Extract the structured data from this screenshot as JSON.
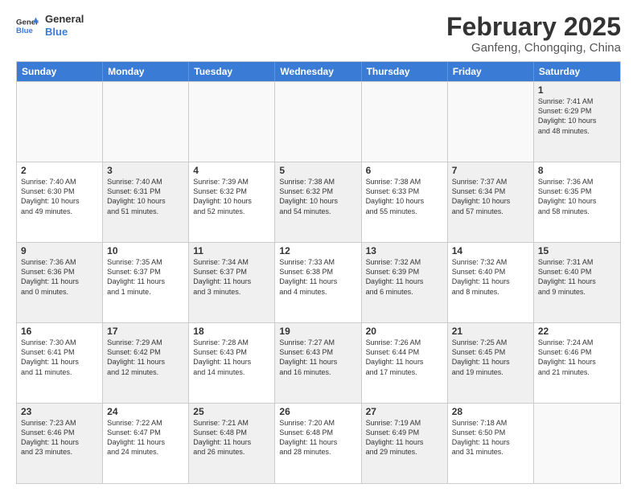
{
  "header": {
    "logo_general": "General",
    "logo_blue": "Blue",
    "main_title": "February 2025",
    "subtitle": "Ganfeng, Chongqing, China"
  },
  "calendar": {
    "days": [
      "Sunday",
      "Monday",
      "Tuesday",
      "Wednesday",
      "Thursday",
      "Friday",
      "Saturday"
    ],
    "rows": [
      [
        {
          "num": "",
          "text": "",
          "empty": true
        },
        {
          "num": "",
          "text": "",
          "empty": true
        },
        {
          "num": "",
          "text": "",
          "empty": true
        },
        {
          "num": "",
          "text": "",
          "empty": true
        },
        {
          "num": "",
          "text": "",
          "empty": true
        },
        {
          "num": "",
          "text": "",
          "empty": true
        },
        {
          "num": "1",
          "text": "Sunrise: 7:41 AM\nSunset: 6:29 PM\nDaylight: 10 hours\nand 48 minutes.",
          "empty": false,
          "shaded": true
        }
      ],
      [
        {
          "num": "2",
          "text": "Sunrise: 7:40 AM\nSunset: 6:30 PM\nDaylight: 10 hours\nand 49 minutes.",
          "empty": false
        },
        {
          "num": "3",
          "text": "Sunrise: 7:40 AM\nSunset: 6:31 PM\nDaylight: 10 hours\nand 51 minutes.",
          "empty": false,
          "shaded": true
        },
        {
          "num": "4",
          "text": "Sunrise: 7:39 AM\nSunset: 6:32 PM\nDaylight: 10 hours\nand 52 minutes.",
          "empty": false
        },
        {
          "num": "5",
          "text": "Sunrise: 7:38 AM\nSunset: 6:32 PM\nDaylight: 10 hours\nand 54 minutes.",
          "empty": false,
          "shaded": true
        },
        {
          "num": "6",
          "text": "Sunrise: 7:38 AM\nSunset: 6:33 PM\nDaylight: 10 hours\nand 55 minutes.",
          "empty": false
        },
        {
          "num": "7",
          "text": "Sunrise: 7:37 AM\nSunset: 6:34 PM\nDaylight: 10 hours\nand 57 minutes.",
          "empty": false,
          "shaded": true
        },
        {
          "num": "8",
          "text": "Sunrise: 7:36 AM\nSunset: 6:35 PM\nDaylight: 10 hours\nand 58 minutes.",
          "empty": false
        }
      ],
      [
        {
          "num": "9",
          "text": "Sunrise: 7:36 AM\nSunset: 6:36 PM\nDaylight: 11 hours\nand 0 minutes.",
          "empty": false,
          "shaded": true
        },
        {
          "num": "10",
          "text": "Sunrise: 7:35 AM\nSunset: 6:37 PM\nDaylight: 11 hours\nand 1 minute.",
          "empty": false
        },
        {
          "num": "11",
          "text": "Sunrise: 7:34 AM\nSunset: 6:37 PM\nDaylight: 11 hours\nand 3 minutes.",
          "empty": false,
          "shaded": true
        },
        {
          "num": "12",
          "text": "Sunrise: 7:33 AM\nSunset: 6:38 PM\nDaylight: 11 hours\nand 4 minutes.",
          "empty": false
        },
        {
          "num": "13",
          "text": "Sunrise: 7:32 AM\nSunset: 6:39 PM\nDaylight: 11 hours\nand 6 minutes.",
          "empty": false,
          "shaded": true
        },
        {
          "num": "14",
          "text": "Sunrise: 7:32 AM\nSunset: 6:40 PM\nDaylight: 11 hours\nand 8 minutes.",
          "empty": false
        },
        {
          "num": "15",
          "text": "Sunrise: 7:31 AM\nSunset: 6:40 PM\nDaylight: 11 hours\nand 9 minutes.",
          "empty": false,
          "shaded": true
        }
      ],
      [
        {
          "num": "16",
          "text": "Sunrise: 7:30 AM\nSunset: 6:41 PM\nDaylight: 11 hours\nand 11 minutes.",
          "empty": false
        },
        {
          "num": "17",
          "text": "Sunrise: 7:29 AM\nSunset: 6:42 PM\nDaylight: 11 hours\nand 12 minutes.",
          "empty": false,
          "shaded": true
        },
        {
          "num": "18",
          "text": "Sunrise: 7:28 AM\nSunset: 6:43 PM\nDaylight: 11 hours\nand 14 minutes.",
          "empty": false
        },
        {
          "num": "19",
          "text": "Sunrise: 7:27 AM\nSunset: 6:43 PM\nDaylight: 11 hours\nand 16 minutes.",
          "empty": false,
          "shaded": true
        },
        {
          "num": "20",
          "text": "Sunrise: 7:26 AM\nSunset: 6:44 PM\nDaylight: 11 hours\nand 17 minutes.",
          "empty": false
        },
        {
          "num": "21",
          "text": "Sunrise: 7:25 AM\nSunset: 6:45 PM\nDaylight: 11 hours\nand 19 minutes.",
          "empty": false,
          "shaded": true
        },
        {
          "num": "22",
          "text": "Sunrise: 7:24 AM\nSunset: 6:46 PM\nDaylight: 11 hours\nand 21 minutes.",
          "empty": false
        }
      ],
      [
        {
          "num": "23",
          "text": "Sunrise: 7:23 AM\nSunset: 6:46 PM\nDaylight: 11 hours\nand 23 minutes.",
          "empty": false,
          "shaded": true
        },
        {
          "num": "24",
          "text": "Sunrise: 7:22 AM\nSunset: 6:47 PM\nDaylight: 11 hours\nand 24 minutes.",
          "empty": false
        },
        {
          "num": "25",
          "text": "Sunrise: 7:21 AM\nSunset: 6:48 PM\nDaylight: 11 hours\nand 26 minutes.",
          "empty": false,
          "shaded": true
        },
        {
          "num": "26",
          "text": "Sunrise: 7:20 AM\nSunset: 6:48 PM\nDaylight: 11 hours\nand 28 minutes.",
          "empty": false
        },
        {
          "num": "27",
          "text": "Sunrise: 7:19 AM\nSunset: 6:49 PM\nDaylight: 11 hours\nand 29 minutes.",
          "empty": false,
          "shaded": true
        },
        {
          "num": "28",
          "text": "Sunrise: 7:18 AM\nSunset: 6:50 PM\nDaylight: 11 hours\nand 31 minutes.",
          "empty": false
        },
        {
          "num": "",
          "text": "",
          "empty": true
        }
      ]
    ]
  }
}
